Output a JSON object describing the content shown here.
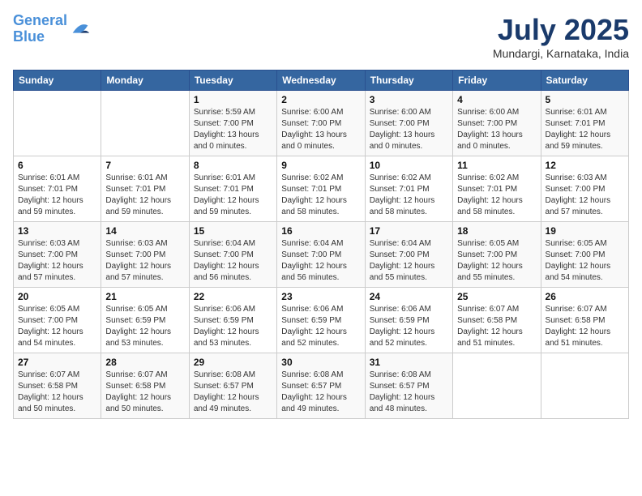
{
  "header": {
    "logo_line1": "General",
    "logo_line2": "Blue",
    "month_year": "July 2025",
    "location": "Mundargi, Karnataka, India"
  },
  "days_of_week": [
    "Sunday",
    "Monday",
    "Tuesday",
    "Wednesday",
    "Thursday",
    "Friday",
    "Saturday"
  ],
  "weeks": [
    [
      {
        "day": "",
        "info": ""
      },
      {
        "day": "",
        "info": ""
      },
      {
        "day": "1",
        "info": "Sunrise: 5:59 AM\nSunset: 7:00 PM\nDaylight: 13 hours\nand 0 minutes."
      },
      {
        "day": "2",
        "info": "Sunrise: 6:00 AM\nSunset: 7:00 PM\nDaylight: 13 hours\nand 0 minutes."
      },
      {
        "day": "3",
        "info": "Sunrise: 6:00 AM\nSunset: 7:00 PM\nDaylight: 13 hours\nand 0 minutes."
      },
      {
        "day": "4",
        "info": "Sunrise: 6:00 AM\nSunset: 7:00 PM\nDaylight: 13 hours\nand 0 minutes."
      },
      {
        "day": "5",
        "info": "Sunrise: 6:01 AM\nSunset: 7:01 PM\nDaylight: 12 hours\nand 59 minutes."
      }
    ],
    [
      {
        "day": "6",
        "info": "Sunrise: 6:01 AM\nSunset: 7:01 PM\nDaylight: 12 hours\nand 59 minutes."
      },
      {
        "day": "7",
        "info": "Sunrise: 6:01 AM\nSunset: 7:01 PM\nDaylight: 12 hours\nand 59 minutes."
      },
      {
        "day": "8",
        "info": "Sunrise: 6:01 AM\nSunset: 7:01 PM\nDaylight: 12 hours\nand 59 minutes."
      },
      {
        "day": "9",
        "info": "Sunrise: 6:02 AM\nSunset: 7:01 PM\nDaylight: 12 hours\nand 58 minutes."
      },
      {
        "day": "10",
        "info": "Sunrise: 6:02 AM\nSunset: 7:01 PM\nDaylight: 12 hours\nand 58 minutes."
      },
      {
        "day": "11",
        "info": "Sunrise: 6:02 AM\nSunset: 7:01 PM\nDaylight: 12 hours\nand 58 minutes."
      },
      {
        "day": "12",
        "info": "Sunrise: 6:03 AM\nSunset: 7:00 PM\nDaylight: 12 hours\nand 57 minutes."
      }
    ],
    [
      {
        "day": "13",
        "info": "Sunrise: 6:03 AM\nSunset: 7:00 PM\nDaylight: 12 hours\nand 57 minutes."
      },
      {
        "day": "14",
        "info": "Sunrise: 6:03 AM\nSunset: 7:00 PM\nDaylight: 12 hours\nand 57 minutes."
      },
      {
        "day": "15",
        "info": "Sunrise: 6:04 AM\nSunset: 7:00 PM\nDaylight: 12 hours\nand 56 minutes."
      },
      {
        "day": "16",
        "info": "Sunrise: 6:04 AM\nSunset: 7:00 PM\nDaylight: 12 hours\nand 56 minutes."
      },
      {
        "day": "17",
        "info": "Sunrise: 6:04 AM\nSunset: 7:00 PM\nDaylight: 12 hours\nand 55 minutes."
      },
      {
        "day": "18",
        "info": "Sunrise: 6:05 AM\nSunset: 7:00 PM\nDaylight: 12 hours\nand 55 minutes."
      },
      {
        "day": "19",
        "info": "Sunrise: 6:05 AM\nSunset: 7:00 PM\nDaylight: 12 hours\nand 54 minutes."
      }
    ],
    [
      {
        "day": "20",
        "info": "Sunrise: 6:05 AM\nSunset: 7:00 PM\nDaylight: 12 hours\nand 54 minutes."
      },
      {
        "day": "21",
        "info": "Sunrise: 6:05 AM\nSunset: 6:59 PM\nDaylight: 12 hours\nand 53 minutes."
      },
      {
        "day": "22",
        "info": "Sunrise: 6:06 AM\nSunset: 6:59 PM\nDaylight: 12 hours\nand 53 minutes."
      },
      {
        "day": "23",
        "info": "Sunrise: 6:06 AM\nSunset: 6:59 PM\nDaylight: 12 hours\nand 52 minutes."
      },
      {
        "day": "24",
        "info": "Sunrise: 6:06 AM\nSunset: 6:59 PM\nDaylight: 12 hours\nand 52 minutes."
      },
      {
        "day": "25",
        "info": "Sunrise: 6:07 AM\nSunset: 6:58 PM\nDaylight: 12 hours\nand 51 minutes."
      },
      {
        "day": "26",
        "info": "Sunrise: 6:07 AM\nSunset: 6:58 PM\nDaylight: 12 hours\nand 51 minutes."
      }
    ],
    [
      {
        "day": "27",
        "info": "Sunrise: 6:07 AM\nSunset: 6:58 PM\nDaylight: 12 hours\nand 50 minutes."
      },
      {
        "day": "28",
        "info": "Sunrise: 6:07 AM\nSunset: 6:58 PM\nDaylight: 12 hours\nand 50 minutes."
      },
      {
        "day": "29",
        "info": "Sunrise: 6:08 AM\nSunset: 6:57 PM\nDaylight: 12 hours\nand 49 minutes."
      },
      {
        "day": "30",
        "info": "Sunrise: 6:08 AM\nSunset: 6:57 PM\nDaylight: 12 hours\nand 49 minutes."
      },
      {
        "day": "31",
        "info": "Sunrise: 6:08 AM\nSunset: 6:57 PM\nDaylight: 12 hours\nand 48 minutes."
      },
      {
        "day": "",
        "info": ""
      },
      {
        "day": "",
        "info": ""
      }
    ]
  ]
}
